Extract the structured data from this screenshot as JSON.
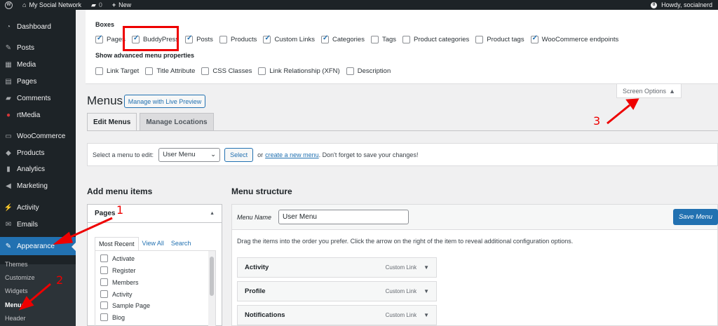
{
  "adminbar": {
    "site_name": "My Social Network",
    "comments_count": "0",
    "new_label": "New",
    "howdy": "Howdy, socialnerd",
    "avatar_badge": "0"
  },
  "sidebar": {
    "items": [
      {
        "label": "Dashboard",
        "icon": "dashboard-icon"
      },
      {
        "label": "Posts",
        "icon": "pin-icon"
      },
      {
        "label": "Media",
        "icon": "media-icon"
      },
      {
        "label": "Pages",
        "icon": "page-icon"
      },
      {
        "label": "Comments",
        "icon": "comment-icon"
      },
      {
        "label": "rtMedia",
        "icon": "rtmedia-icon"
      },
      {
        "label": "WooCommerce",
        "icon": "woo-icon"
      },
      {
        "label": "Products",
        "icon": "box-icon"
      },
      {
        "label": "Analytics",
        "icon": "bar-chart-icon"
      },
      {
        "label": "Marketing",
        "icon": "megaphone-icon"
      },
      {
        "label": "Activity",
        "icon": "activity-icon"
      },
      {
        "label": "Emails",
        "icon": "mail-icon"
      },
      {
        "label": "Appearance",
        "icon": "brush-icon"
      }
    ],
    "submenu": [
      "Themes",
      "Customize",
      "Widgets",
      "Menus",
      "Header"
    ]
  },
  "screen_options": {
    "boxes_heading": "Boxes",
    "boxes": [
      {
        "label": "Pages",
        "checked": true
      },
      {
        "label": "BuddyPress",
        "checked": true
      },
      {
        "label": "Posts",
        "checked": true
      },
      {
        "label": "Products",
        "checked": false
      },
      {
        "label": "Custom Links",
        "checked": true
      },
      {
        "label": "Categories",
        "checked": true
      },
      {
        "label": "Tags",
        "checked": false
      },
      {
        "label": "Product categories",
        "checked": false
      },
      {
        "label": "Product tags",
        "checked": false
      },
      {
        "label": "WooCommerce endpoints",
        "checked": true
      }
    ],
    "advanced_heading": "Show advanced menu properties",
    "advanced": [
      {
        "label": "Link Target",
        "checked": false
      },
      {
        "label": "Title Attribute",
        "checked": false
      },
      {
        "label": "CSS Classes",
        "checked": false
      },
      {
        "label": "Link Relationship (XFN)",
        "checked": false
      },
      {
        "label": "Description",
        "checked": false
      }
    ],
    "tab_label": "Screen Options"
  },
  "main": {
    "title": "Menus",
    "live_preview": "Manage with Live Preview",
    "tabs": [
      "Edit Menus",
      "Manage Locations"
    ],
    "select_label": "Select a menu to edit:",
    "selected_menu": "User Menu",
    "select_button": "Select",
    "or_text": "or",
    "create_link": "create a new menu",
    "dont_forget": ". Don't forget to save your changes!"
  },
  "add_items": {
    "heading": "Add menu items",
    "panel_title": "Pages",
    "subtabs": [
      "Most Recent",
      "View All",
      "Search"
    ],
    "pages": [
      "Activate",
      "Register",
      "Members",
      "Activity",
      "Sample Page",
      "Blog"
    ]
  },
  "structure": {
    "heading": "Menu structure",
    "name_label": "Menu Name",
    "name_value": "User Menu",
    "save_label": "Save Menu",
    "instructions": "Drag the items into the order you prefer. Click the arrow on the right of the item to reveal additional configuration options.",
    "items": [
      {
        "label": "Activity",
        "type": "Custom Link"
      },
      {
        "label": "Profile",
        "type": "Custom Link"
      },
      {
        "label": "Notifications",
        "type": "Custom Link"
      }
    ]
  },
  "annotations": [
    "1",
    "2",
    "3"
  ],
  "colors": {
    "accent": "#2271b1",
    "annotation": "#ee0000",
    "sidebar": "#1d2327"
  }
}
